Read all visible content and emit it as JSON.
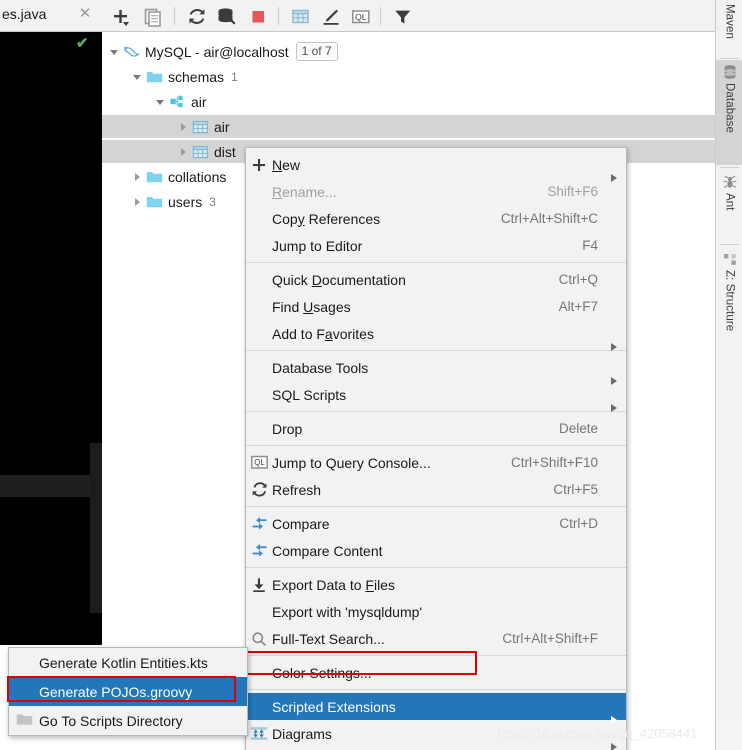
{
  "editor": {
    "tab_label": "es.java",
    "close_icon": "close-icon",
    "inspection_ok_icon": "green-check-icon"
  },
  "toolbar": {
    "items": [
      {
        "name": "add-dropdown-button",
        "icon": "plus-with-chevron-icon"
      },
      {
        "name": "duplicate-button",
        "icon": "copy-icon"
      },
      {
        "name": "synchronize-button",
        "icon": "refresh-icon"
      },
      {
        "name": "data-sources-properties-button",
        "icon": "db-wrench-icon"
      },
      {
        "name": "stop-button",
        "icon": "red-square-icon",
        "color": "#e8565a"
      },
      {
        "name": "open-table-editor-button",
        "icon": "table-icon"
      },
      {
        "name": "modify-table-button",
        "icon": "pencil-icon"
      },
      {
        "name": "jump-to-query-console-button",
        "icon": "ql-console-icon"
      },
      {
        "name": "filter-button",
        "icon": "funnel-icon"
      }
    ]
  },
  "tree": {
    "rows": [
      {
        "indent": 0,
        "twisty": "down",
        "icon": "mysql-dolphin-icon",
        "label": "MySQL - air@localhost",
        "badge": "1 of 7",
        "count": "",
        "selected": false
      },
      {
        "indent": 1,
        "twisty": "down",
        "icon": "folder-icon",
        "label": "schemas",
        "badge": "",
        "count": "1",
        "selected": false
      },
      {
        "indent": 2,
        "twisty": "down",
        "icon": "schema-icon",
        "label": "air",
        "badge": "",
        "count": "",
        "selected": false
      },
      {
        "indent": 3,
        "twisty": "right",
        "icon": "table-grid-icon",
        "label": "air",
        "badge": "",
        "count": "",
        "selected": true
      },
      {
        "indent": 3,
        "twisty": "right",
        "icon": "table-grid-icon",
        "label": "dist",
        "badge": "",
        "count": "",
        "selected": true
      },
      {
        "indent": 1,
        "twisty": "right",
        "icon": "folder-icon",
        "label": "collations",
        "badge": "",
        "count": "",
        "selected": false
      },
      {
        "indent": 1,
        "twisty": "right",
        "icon": "folder-icon",
        "label": "users",
        "badge": "",
        "count": "3",
        "selected": false
      }
    ]
  },
  "right_tool_tabs": [
    {
      "label": "Maven",
      "icon": "maven-icon",
      "active": false,
      "has_icon": false
    },
    {
      "label": "Database",
      "icon": "database-icon",
      "active": true,
      "has_icon": true
    },
    {
      "label": "Ant",
      "icon": "ant-bug-icon",
      "active": false,
      "has_icon": true
    },
    {
      "label": "Z: Structure",
      "icon": "structure-icon",
      "active": false,
      "has_icon": true
    }
  ],
  "context_menu": {
    "items": [
      {
        "label": "New",
        "shortcut": "",
        "icon": "plus-icon",
        "arrow": true,
        "disabled": false,
        "highlighted": false,
        "underline_index": 0,
        "sep_after": false
      },
      {
        "label": "Rename...",
        "shortcut": "Shift+F6",
        "icon": "",
        "arrow": false,
        "disabled": true,
        "highlighted": false,
        "underline_index": 0,
        "sep_after": false
      },
      {
        "label": "Copy References",
        "shortcut": "Ctrl+Alt+Shift+C",
        "icon": "",
        "arrow": false,
        "disabled": false,
        "highlighted": false,
        "underline_index": 3,
        "sep_after": false
      },
      {
        "label": "Jump to Editor",
        "shortcut": "F4",
        "icon": "",
        "arrow": false,
        "disabled": false,
        "highlighted": false,
        "underline_index": -1,
        "sep_after": true
      },
      {
        "label": "Quick Documentation",
        "shortcut": "Ctrl+Q",
        "icon": "",
        "arrow": false,
        "disabled": false,
        "highlighted": false,
        "underline_index": 6,
        "sep_after": false
      },
      {
        "label": "Find Usages",
        "shortcut": "Alt+F7",
        "icon": "",
        "arrow": false,
        "disabled": false,
        "highlighted": false,
        "underline_index": 5,
        "sep_after": false
      },
      {
        "label": "Add to Favorites",
        "shortcut": "",
        "icon": "",
        "arrow": true,
        "disabled": false,
        "highlighted": false,
        "underline_index": 8,
        "sep_after": true
      },
      {
        "label": "Database Tools",
        "shortcut": "",
        "icon": "",
        "arrow": true,
        "disabled": false,
        "highlighted": false,
        "underline_index": -1,
        "sep_after": false
      },
      {
        "label": "SQL Scripts",
        "shortcut": "",
        "icon": "",
        "arrow": true,
        "disabled": false,
        "highlighted": false,
        "underline_index": -1,
        "sep_after": true
      },
      {
        "label": "Drop",
        "shortcut": "Delete",
        "icon": "",
        "arrow": false,
        "disabled": false,
        "highlighted": false,
        "underline_index": -1,
        "sep_after": true
      },
      {
        "label": "Jump to Query Console...",
        "shortcut": "Ctrl+Shift+F10",
        "icon": "ql-console-icon",
        "arrow": false,
        "disabled": false,
        "highlighted": false,
        "underline_index": -1,
        "sep_after": false
      },
      {
        "label": "Refresh",
        "shortcut": "Ctrl+F5",
        "icon": "refresh-icon",
        "arrow": false,
        "disabled": false,
        "highlighted": false,
        "underline_index": -1,
        "sep_after": true
      },
      {
        "label": "Compare",
        "shortcut": "Ctrl+D",
        "icon": "compare-icon",
        "arrow": false,
        "disabled": false,
        "highlighted": false,
        "underline_index": -1,
        "sep_after": false
      },
      {
        "label": "Compare Content",
        "shortcut": "",
        "icon": "compare-icon",
        "arrow": false,
        "disabled": false,
        "highlighted": false,
        "underline_index": -1,
        "sep_after": true
      },
      {
        "label": "Export Data to Files",
        "shortcut": "",
        "icon": "export-down-icon",
        "arrow": false,
        "disabled": false,
        "highlighted": false,
        "underline_index": 15,
        "sep_after": false
      },
      {
        "label": "Export with 'mysqldump'",
        "shortcut": "",
        "icon": "",
        "arrow": false,
        "disabled": false,
        "highlighted": false,
        "underline_index": -1,
        "sep_after": false
      },
      {
        "label": "Full-Text Search...",
        "shortcut": "Ctrl+Alt+Shift+F",
        "icon": "search-icon",
        "arrow": false,
        "disabled": false,
        "highlighted": false,
        "underline_index": -1,
        "sep_after": true
      },
      {
        "label": "Color Settings...",
        "shortcut": "",
        "icon": "",
        "arrow": false,
        "disabled": false,
        "highlighted": false,
        "underline_index": -1,
        "sep_after": true
      },
      {
        "label": "Scripted Extensions",
        "shortcut": "",
        "icon": "",
        "arrow": true,
        "disabled": false,
        "highlighted": true,
        "underline_index": -1,
        "sep_after": false
      },
      {
        "label": "Diagrams",
        "shortcut": "",
        "icon": "diagrams-icon",
        "arrow": true,
        "disabled": false,
        "highlighted": false,
        "underline_index": -1,
        "sep_after": false
      }
    ]
  },
  "scripted_extensions_submenu": {
    "items": [
      {
        "label": "Generate Kotlin Entities.kts",
        "icon": "",
        "highlighted": false
      },
      {
        "label": "Generate POJOs.groovy",
        "icon": "",
        "highlighted": true
      },
      {
        "label": "Go To Scripts Directory",
        "icon": "folder-icon",
        "highlighted": false
      }
    ]
  },
  "annotations": {
    "highlight_color": "#e00000",
    "selection_color": "#2277bb"
  },
  "watermark": "https://blog.csdn.net/qq_42058441"
}
